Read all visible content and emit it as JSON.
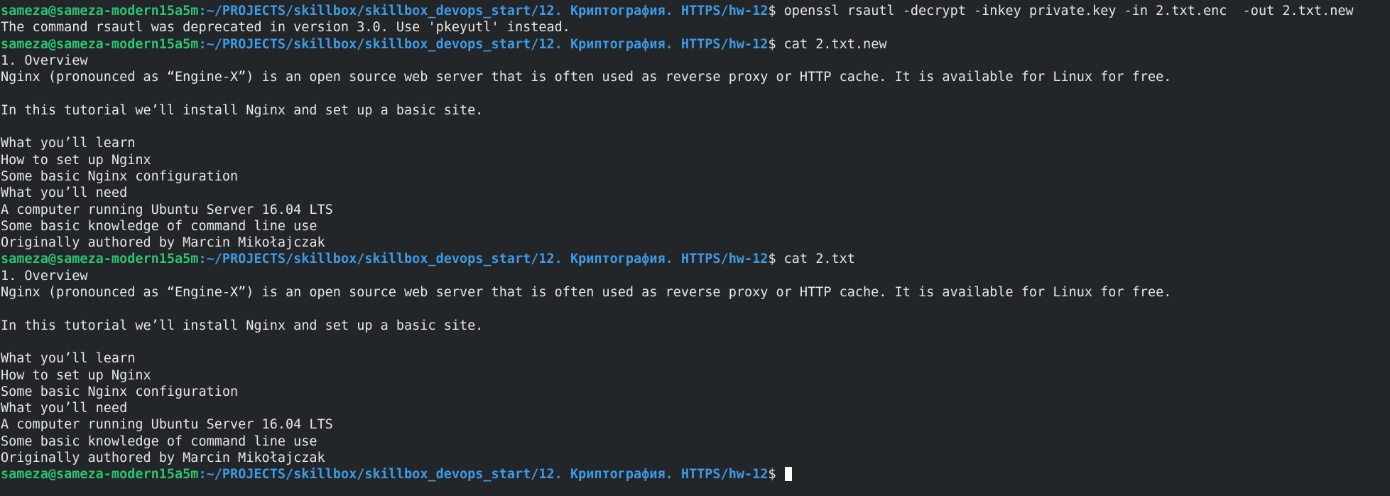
{
  "prompt": {
    "user_host": "sameza@sameza-modern15a5m",
    "separator": ":",
    "path": "~/PROJECTS/skillbox/skillbox_devops_start/12. Криптография. HTTPS/hw-12",
    "symbol": "$ "
  },
  "session": [
    {
      "type": "prompt",
      "command": "openssl rsautl -decrypt -inkey private.key -in 2.txt.enc  -out 2.txt.new"
    },
    {
      "type": "output",
      "text": "The command rsautl was deprecated in version 3.0. Use 'pkeyutl' instead."
    },
    {
      "type": "prompt",
      "command": "cat 2.txt.new"
    },
    {
      "type": "output",
      "text": "1. Overview"
    },
    {
      "type": "output",
      "text": "Nginx (pronounced as “Engine-X”) is an open source web server that is often used as reverse proxy or HTTP cache. It is available for Linux for free."
    },
    {
      "type": "output",
      "text": ""
    },
    {
      "type": "output",
      "text": "In this tutorial we’ll install Nginx and set up a basic site."
    },
    {
      "type": "output",
      "text": ""
    },
    {
      "type": "output",
      "text": "What you’ll learn"
    },
    {
      "type": "output",
      "text": "How to set up Nginx"
    },
    {
      "type": "output",
      "text": "Some basic Nginx configuration"
    },
    {
      "type": "output",
      "text": "What you’ll need"
    },
    {
      "type": "output",
      "text": "A computer running Ubuntu Server 16.04 LTS"
    },
    {
      "type": "output",
      "text": "Some basic knowledge of command line use"
    },
    {
      "type": "output",
      "text": "Originally authored by Marcin Mikołajczak"
    },
    {
      "type": "prompt",
      "command": "cat 2.txt"
    },
    {
      "type": "output",
      "text": "1. Overview"
    },
    {
      "type": "output",
      "text": "Nginx (pronounced as “Engine-X”) is an open source web server that is often used as reverse proxy or HTTP cache. It is available for Linux for free."
    },
    {
      "type": "output",
      "text": ""
    },
    {
      "type": "output",
      "text": "In this tutorial we’ll install Nginx and set up a basic site."
    },
    {
      "type": "output",
      "text": ""
    },
    {
      "type": "output",
      "text": "What you’ll learn"
    },
    {
      "type": "output",
      "text": "How to set up Nginx"
    },
    {
      "type": "output",
      "text": "Some basic Nginx configuration"
    },
    {
      "type": "output",
      "text": "What you’ll need"
    },
    {
      "type": "output",
      "text": "A computer running Ubuntu Server 16.04 LTS"
    },
    {
      "type": "output",
      "text": "Some basic knowledge of command line use"
    },
    {
      "type": "output",
      "text": "Originally authored by Marcin Mikołajczak"
    },
    {
      "type": "prompt",
      "command": "",
      "cursor": true
    }
  ],
  "colors": {
    "background": "#232629",
    "text": "#e6e6e6",
    "user_host": "#2bc46f",
    "path": "#3d9be6"
  }
}
